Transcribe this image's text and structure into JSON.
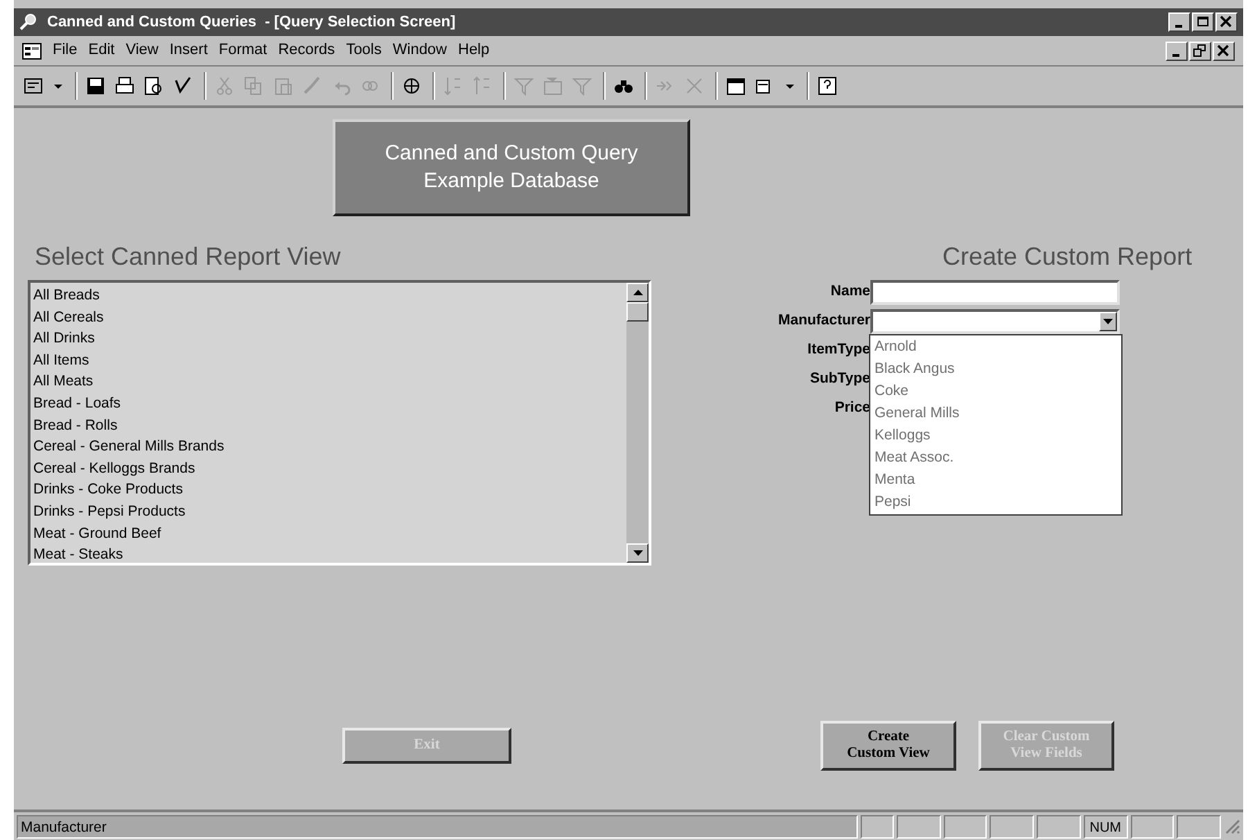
{
  "window": {
    "title": "Canned and Custom Queries  - [Query Selection Screen]"
  },
  "menu": [
    "File",
    "Edit",
    "View",
    "Insert",
    "Format",
    "Records",
    "Tools",
    "Window",
    "Help"
  ],
  "banner": {
    "lines": [
      "Canned and Custom Query",
      "Example Database"
    ]
  },
  "canned": {
    "title": "Select Canned Report View",
    "items": [
      "All Breads",
      "All Cereals",
      "All Drinks",
      "All Items",
      "All Meats",
      "Bread - Loafs",
      "Bread - Rolls",
      "Cereal - General Mills Brands",
      "Cereal - Kelloggs Brands",
      "Drinks - Coke Products",
      "Drinks - Pepsi Products",
      "Meat - Ground Beef",
      "Meat - Steaks"
    ]
  },
  "custom": {
    "title": "Create Custom Report",
    "fields": [
      {
        "label": "Name",
        "kind": "text"
      },
      {
        "label": "Manufacturer",
        "kind": "combo",
        "expanded": true,
        "options": [
          "Arnold",
          "Black Angus",
          "Coke",
          "General Mills",
          "Kelloggs",
          "Meat Assoc.",
          "Menta",
          "Pepsi"
        ]
      },
      {
        "label": "ItemType",
        "kind": "covered"
      },
      {
        "label": "SubType",
        "kind": "covered"
      },
      {
        "label": "Price",
        "kind": "covered"
      }
    ]
  },
  "buttons": [
    {
      "lines": [
        "Exit"
      ],
      "disabled": true
    },
    {
      "lines": [
        "Create",
        "Custom View"
      ],
      "disabled": false
    },
    {
      "lines": [
        "Clear Custom",
        "View Fields"
      ],
      "disabled": true
    }
  ],
  "status_bar": {
    "message": "Manufacturer",
    "indicator": "NUM"
  }
}
